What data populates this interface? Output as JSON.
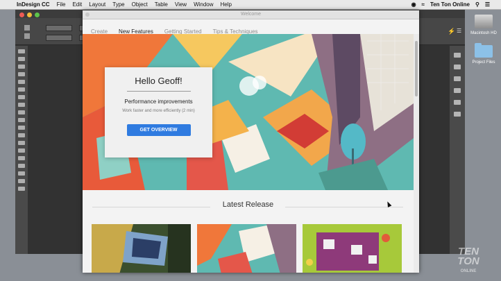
{
  "menubar": {
    "app_name": "InDesign CC",
    "items": [
      "File",
      "Edit",
      "Layout",
      "Type",
      "Object",
      "Table",
      "View",
      "Window",
      "Help"
    ],
    "right_text": "Ten Ton Online"
  },
  "desktop": {
    "hd_label": "Macintosh HD",
    "folder_label": "Project Files"
  },
  "welcome": {
    "window_title": "Welcome",
    "tabs": [
      "Create",
      "New Features",
      "Getting Started",
      "Tips & Techniques"
    ],
    "active_tab": "New Features",
    "card": {
      "greeting": "Hello Geoff!",
      "heading": "Performance improvements",
      "description": "Work faster and more efficiently (2 min)",
      "button_label": "GET OVERVIEW"
    },
    "section_title": "Latest Release"
  },
  "watermark": {
    "line1": "TEN",
    "line2": "TON",
    "line3": "ONLINE"
  },
  "colors": {
    "accent": "#2f7be0",
    "hero_teal": "#5fb9b1"
  }
}
